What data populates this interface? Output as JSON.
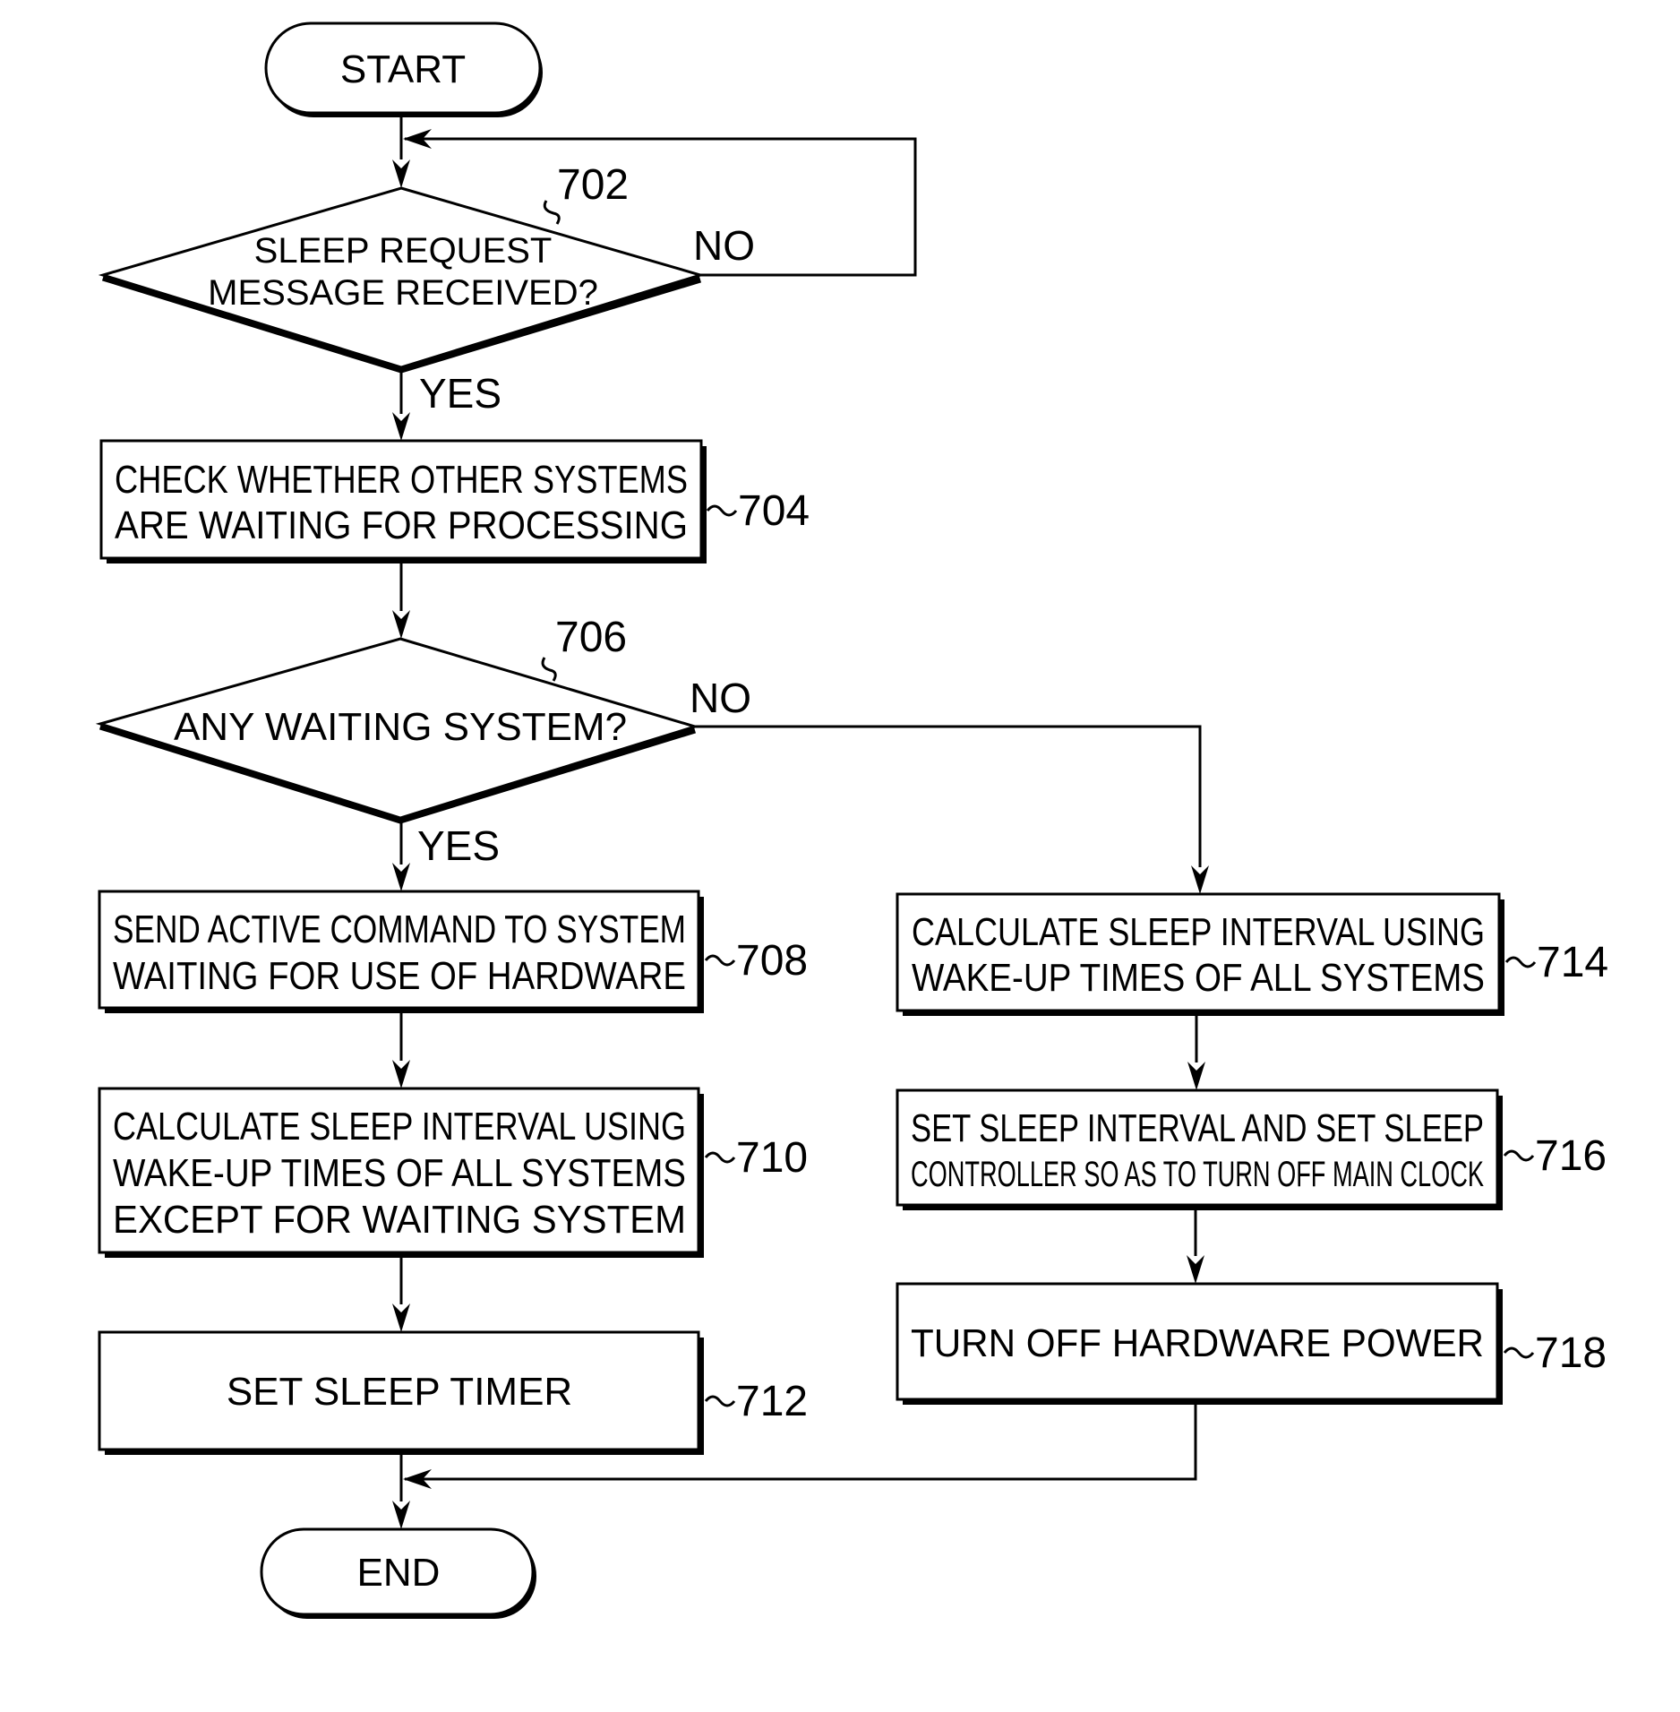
{
  "diagram": {
    "type": "flowchart",
    "terminals": {
      "start": "START",
      "end": "END"
    },
    "decisions": [
      {
        "ref": "702",
        "lines": [
          "SLEEP REQUEST",
          "MESSAGE RECEIVED?"
        ],
        "yes_label": "YES",
        "no_label": "NO"
      },
      {
        "ref": "706",
        "lines": [
          "ANY WAITING SYSTEM?"
        ],
        "yes_label": "YES",
        "no_label": "NO"
      }
    ],
    "processes": [
      {
        "ref": "704",
        "lines": [
          "CHECK WHETHER OTHER SYSTEMS",
          "ARE WAITING FOR PROCESSING"
        ]
      },
      {
        "ref": "708",
        "lines": [
          "SEND ACTIVE COMMAND TO SYSTEM",
          "WAITING FOR USE OF HARDWARE"
        ]
      },
      {
        "ref": "710",
        "lines": [
          "CALCULATE SLEEP INTERVAL USING",
          "WAKE-UP TIMES OF ALL SYSTEMS",
          "EXCEPT FOR WAITING SYSTEM"
        ]
      },
      {
        "ref": "712",
        "lines": [
          "SET SLEEP TIMER"
        ]
      },
      {
        "ref": "714",
        "lines": [
          "CALCULATE SLEEP INTERVAL USING",
          "WAKE-UP TIMES OF ALL SYSTEMS"
        ]
      },
      {
        "ref": "716",
        "lines": [
          "SET SLEEP INTERVAL AND SET SLEEP",
          "CONTROLLER SO AS TO TURN OFF MAIN CLOCK"
        ]
      },
      {
        "ref": "718",
        "lines": [
          "TURN OFF HARDWARE POWER"
        ]
      }
    ],
    "edges": [
      {
        "from": "START",
        "to": "702"
      },
      {
        "from": "702",
        "to": "702",
        "label": "NO"
      },
      {
        "from": "702",
        "to": "704",
        "label": "YES"
      },
      {
        "from": "704",
        "to": "706"
      },
      {
        "from": "706",
        "to": "708",
        "label": "YES"
      },
      {
        "from": "706",
        "to": "714",
        "label": "NO"
      },
      {
        "from": "708",
        "to": "710"
      },
      {
        "from": "710",
        "to": "712"
      },
      {
        "from": "712",
        "to": "END"
      },
      {
        "from": "714",
        "to": "716"
      },
      {
        "from": "716",
        "to": "718"
      },
      {
        "from": "718",
        "to": "END"
      }
    ]
  }
}
